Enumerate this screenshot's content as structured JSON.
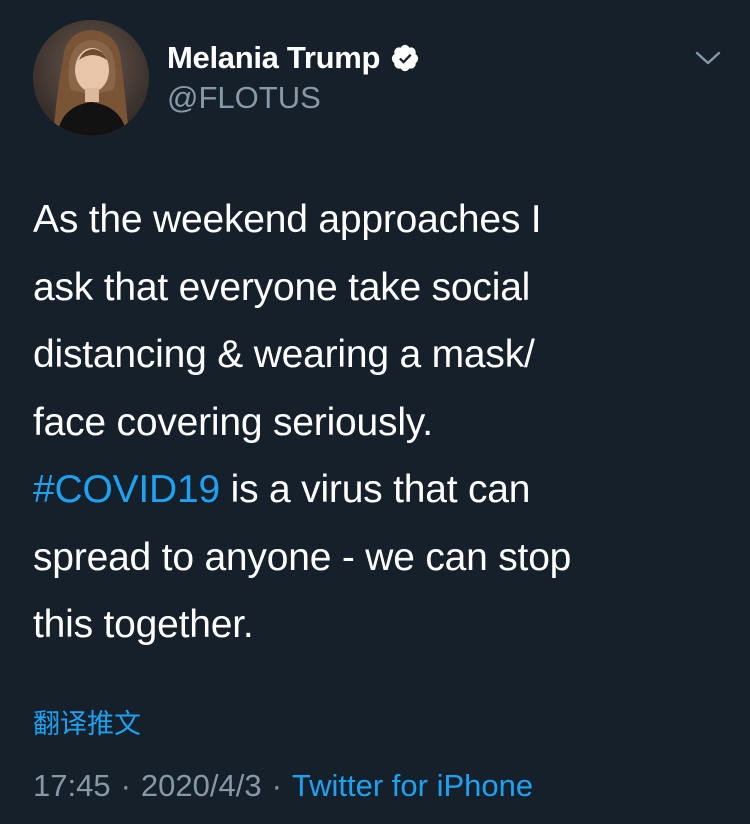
{
  "tweet": {
    "author": {
      "display_name": "Melania Trump",
      "handle": "@FLOTUS",
      "verified": true,
      "avatar_icon": "profile-photo"
    },
    "text_lines": [
      "As the weekend approaches I",
      "ask that everyone take social",
      "distancing & wearing a mask/",
      "face covering seriously."
    ],
    "hashtag": "#COVID19",
    "text_after_hashtag": " is a virus that can",
    "text_lines_after": [
      "spread to anyone - we can stop",
      "this together."
    ],
    "translate_label": "翻译推文",
    "time": "17:45",
    "date": "2020/4/3",
    "separator": "·",
    "source": "Twitter for iPhone",
    "more_icon": "chevron-down-icon"
  },
  "colors": {
    "background": "#15202b",
    "text": "#ffffff",
    "secondary": "#8899a6",
    "accent": "#1da1f2"
  }
}
